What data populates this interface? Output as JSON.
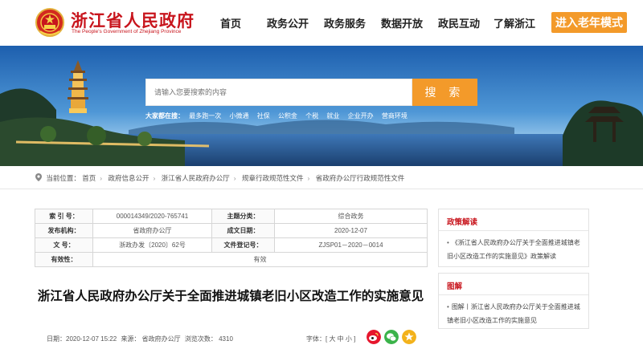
{
  "header": {
    "site_title": "浙江省人民政府",
    "site_subtitle": "The People's Government of Zhejiang Province",
    "nav": [
      "首页",
      "政务公开",
      "政务服务",
      "数据开放",
      "政民互动",
      "了解浙江"
    ],
    "elder_mode": "进入老年模式",
    "colors": {
      "brand_red": "#c8151d",
      "accent_orange": "#f39a2a"
    }
  },
  "search": {
    "placeholder": "请输入您要搜索的内容",
    "button": "搜 索",
    "hot_label": "大家都在搜：",
    "hot_terms": [
      "最多跑一次",
      "小微通",
      "社保",
      "公积金",
      "个税",
      "就业",
      "企业开办",
      "营商环境"
    ]
  },
  "breadcrumb": {
    "prefix": "当前位置：",
    "items": [
      "首页",
      "政府信息公开",
      "浙江省人民政府办公厅",
      "规章行政规范性文件",
      "省政府办公厅行政规范性文件"
    ]
  },
  "info": {
    "index_label": "索 引 号：",
    "index_value": "000014349/2020-765741",
    "category_label": "主题分类：",
    "category_value": "综合政务",
    "org_label": "发布机构：",
    "org_value": "省政府办公厅",
    "date_label": "成文日期：",
    "date_value": "2020-12-07",
    "doc_label": "文 号：",
    "doc_value": "浙政办发〔2020〕62号",
    "reg_label": "文件登记号：",
    "reg_value": "ZJSP01－2020－0014",
    "valid_label": "有效性：",
    "valid_value": "有效"
  },
  "article": {
    "title": "浙江省人民政府办公厅关于全面推进城镇老旧小区改造工作的实施意见",
    "date": "日期：2020-12-07 15:22",
    "source": "来源： 省政府办公厅",
    "views": "浏览次数： 4310",
    "font_size": "字体：[ 大 中 小 ]"
  },
  "sidebar": {
    "policy_head": "政策解读",
    "policy_item": "《浙江省人民政府办公厅关于全面推进城镇老旧小区改造工作的实施意见》政策解读",
    "graphic_head": "图解",
    "graphic_item": "图解丨浙江省人民政府办公厅关于全面推进城镇老旧小区改造工作的实施意见"
  }
}
